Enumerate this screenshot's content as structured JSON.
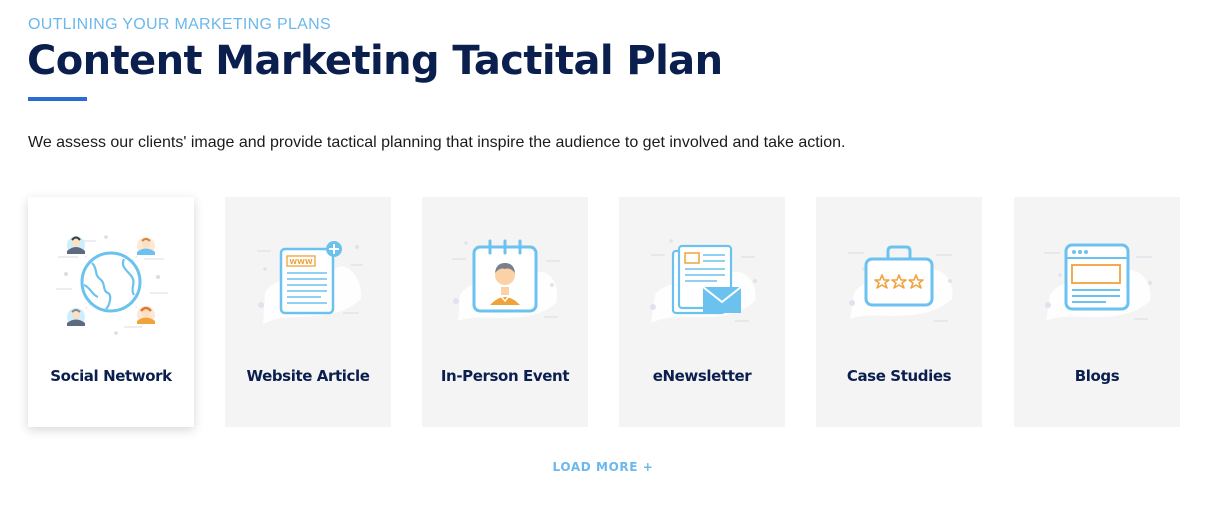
{
  "header": {
    "eyebrow": "OUTLINING YOUR MARKETING PLANS",
    "title": "Content Marketing Tactital Plan",
    "description": "We assess our clients' image and provide tactical planning that inspire the audience to get involved and take action."
  },
  "cards": [
    {
      "label": "Social Network",
      "icon": "globe-network-icon"
    },
    {
      "label": "Website Article",
      "icon": "web-document-icon"
    },
    {
      "label": "In-Person Event",
      "icon": "calendar-person-icon"
    },
    {
      "label": "eNewsletter",
      "icon": "newsletter-envelope-icon"
    },
    {
      "label": "Case Studies",
      "icon": "briefcase-stars-icon"
    },
    {
      "label": "Blogs",
      "icon": "browser-window-icon"
    }
  ],
  "cta": {
    "load_more": "LOAD MORE +"
  },
  "icon_texts": {
    "www": "WWW"
  },
  "colors": {
    "accent_blue": "#6bb8ec",
    "navy": "#0b1f4f",
    "underline": "#2a6bd6",
    "card_bg": "#f4f4f5",
    "icon_orange": "#f0a23b"
  }
}
